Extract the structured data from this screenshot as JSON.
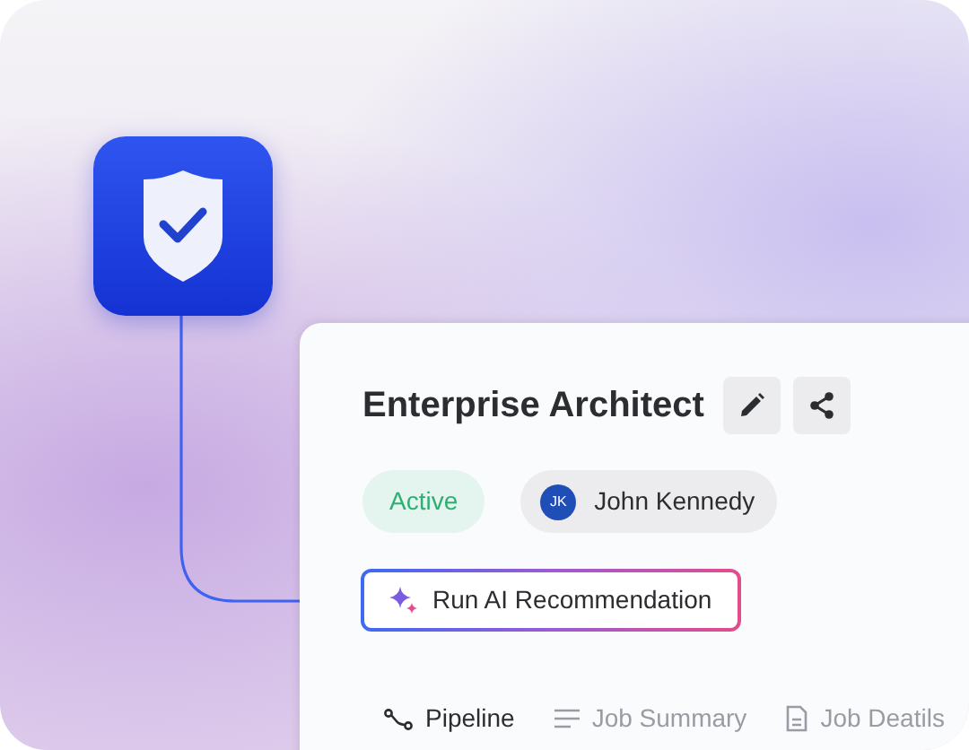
{
  "job": {
    "title": "Enterprise Architect",
    "status": "Active",
    "owner": {
      "initials": "JK",
      "name": "John Kennedy"
    }
  },
  "action": {
    "label": "Run AI Recommendation"
  },
  "tabs": [
    {
      "label": "Pipeline",
      "kind": "pipeline",
      "selected": true
    },
    {
      "label": "Job Summary",
      "kind": "summary",
      "selected": false
    },
    {
      "label": "Job Deatils",
      "kind": "details",
      "selected": false
    }
  ]
}
